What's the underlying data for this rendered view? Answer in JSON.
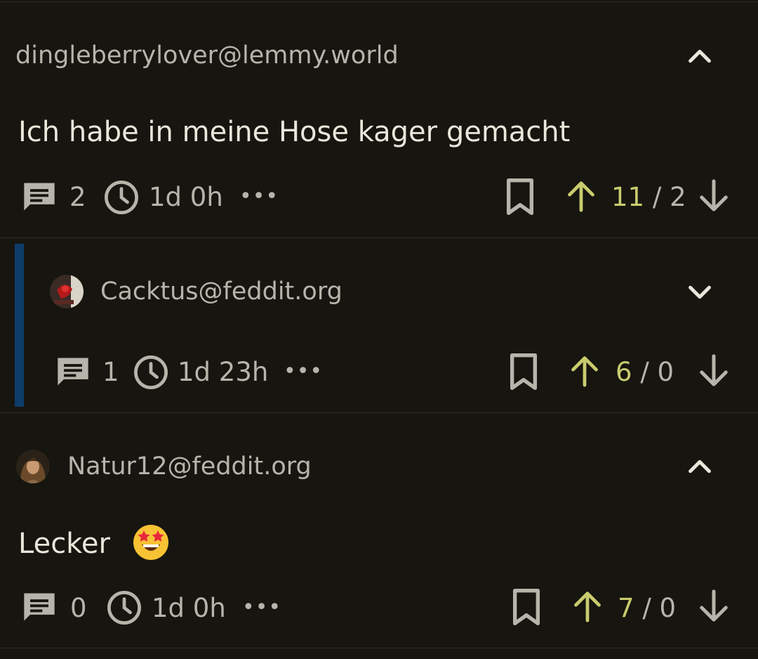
{
  "comments": [
    {
      "author": "dingleberrylover@lemmy.world",
      "text": "Ich habe in meine Hose kager gemacht",
      "reply_count": "2",
      "age": "1d 0h",
      "more": "•••",
      "upvotes": "11",
      "separator": "/",
      "downvotes": "2",
      "expanded": true
    },
    {
      "author": "Cacktus@feddit.org",
      "text": "",
      "reply_count": "1",
      "age": "1d 23h",
      "more": "•••",
      "upvotes": "6",
      "separator": "/",
      "downvotes": "0",
      "expanded": false
    },
    {
      "author": "Natur12@feddit.org",
      "text": "Lecker",
      "emoji": "star-struck",
      "reply_count": "0",
      "age": "1d 0h",
      "more": "•••",
      "upvotes": "7",
      "separator": "/",
      "downvotes": "0",
      "expanded": true
    }
  ],
  "colors": {
    "background": "#16150f",
    "upvote": "#c9cc6e",
    "thread_bar": "#0e3c6a",
    "text": "#e9e6dc",
    "muted": "#b7b4ab"
  },
  "icons": {
    "comment": "comment-icon",
    "clock": "clock-icon",
    "bookmark": "bookmark-icon",
    "upvote": "arrow-up-icon",
    "downvote": "arrow-down-icon",
    "collapse": "chevron-up-icon",
    "expand": "chevron-down-icon"
  }
}
